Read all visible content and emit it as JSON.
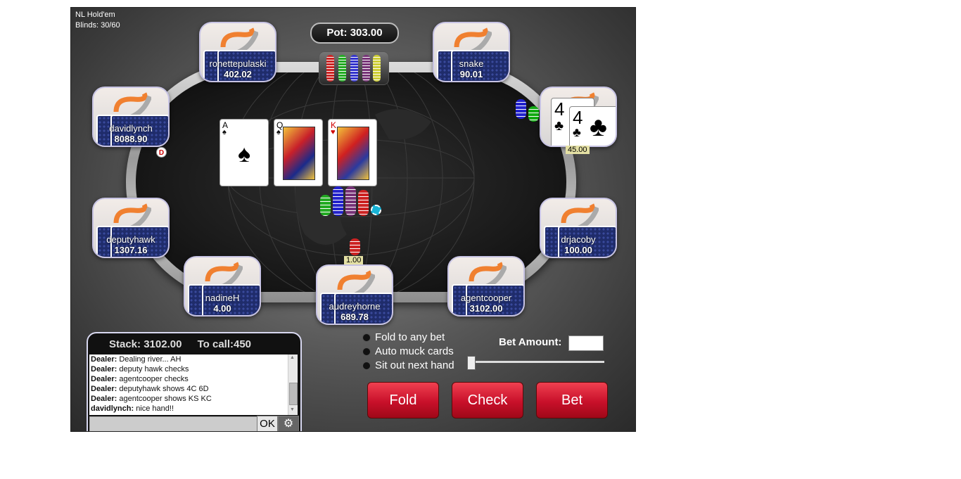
{
  "game": {
    "type": "NL Hold'em",
    "blinds": "Blinds: 30/60"
  },
  "pot_label": "Pot: 303.00",
  "seats": [
    {
      "name": "ronettepulaski",
      "stack": "402.02"
    },
    {
      "name": "snake",
      "stack": "90.01"
    },
    {
      "name": "davidlynch",
      "stack": "8088.90"
    },
    {
      "name": "deputyhawk",
      "stack": "1307.16"
    },
    {
      "name": "drjacoby",
      "stack": "100.00"
    },
    {
      "name": "nadineH",
      "stack": "4.00"
    },
    {
      "name": "audreyhorne",
      "stack": "689.78"
    },
    {
      "name": "agentcooper",
      "stack": "3102.00"
    }
  ],
  "revealed_hand": {
    "cards": [
      {
        "rank": "4",
        "suit": "♣"
      },
      {
        "rank": "4",
        "suit": "♣"
      }
    ],
    "bet": "45.00"
  },
  "dealer_button": "D",
  "board": [
    {
      "rank": "A",
      "suit": "♠",
      "color": "#000000"
    },
    {
      "rank": "Q",
      "suit": "♠",
      "color": "#000000"
    },
    {
      "rank": "K",
      "suit": "♥",
      "color": "#d00000"
    }
  ],
  "audrey_bet": "1.00",
  "stack_info": {
    "stack": "Stack: 3102.00",
    "to_call": "To call:450"
  },
  "chat_log": [
    {
      "who": "Dealer:",
      "msg": "Dealing river... AH"
    },
    {
      "who": "Dealer:",
      "msg": "deputy hawk checks"
    },
    {
      "who": "Dealer:",
      "msg": "agentcooper checks"
    },
    {
      "who": "Dealer:",
      "msg": "deputyhawk shows 4C 6D"
    },
    {
      "who": "Dealer:",
      "msg": "agentcooper shows KS KC"
    },
    {
      "who": "davidlynch:",
      "msg": "nice hand!!"
    }
  ],
  "chat_ok": "OK",
  "options": [
    "Fold to any bet",
    "Auto muck cards",
    "Sit out next hand"
  ],
  "bet_amount_label": "Bet Amount:",
  "actions": {
    "fold": "Fold",
    "check": "Check",
    "bet": "Bet"
  },
  "colors": {
    "action_red": "#c8102a",
    "seat_border": "#c7c3e3",
    "bet_label_bg": "#e4e0a4"
  }
}
